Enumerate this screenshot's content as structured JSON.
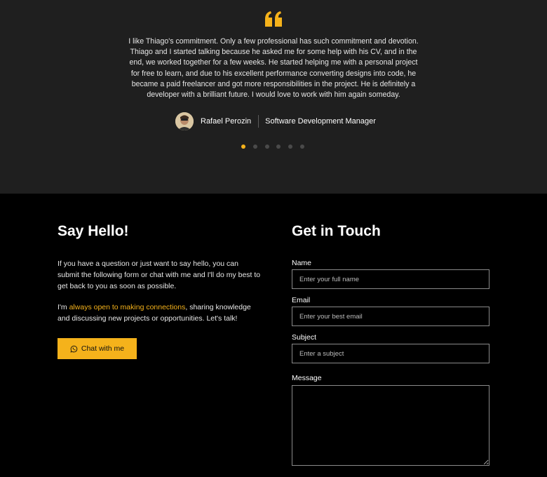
{
  "testimonial": {
    "quote_icon": "quote-icon",
    "text": "I like Thiago's commitment. Only a few professional has such commitment and devotion. Thiago and I started talking because he asked me for some help with his CV, and in the end, we worked together for a few weeks. He started helping me with a personal project for free to learn, and due to his excellent performance converting designs into code, he became a paid freelancer and got more responsibilities in the project. He is definitely a developer with a brilliant future. I would love to work with him again someday.",
    "author_name": "Rafael Perozin",
    "author_role": "Software Development Manager",
    "slide_count": 6,
    "active_slide": 1
  },
  "hello": {
    "title": "Say Hello!",
    "paragraph1": "If you have a question or just want to say hello, you can submit the following form or chat with me and I'll do my best to get back to you as soon as possible.",
    "paragraph2_prefix": "I'm ",
    "paragraph2_highlight": "always open to making connections",
    "paragraph2_suffix": ", sharing knowledge and discussing new projects or opportunities. Let's talk!",
    "chat_button_label": "Chat with me",
    "chat_button_icon": "whatsapp-icon"
  },
  "contact": {
    "title": "Get in Touch",
    "name_label": "Name",
    "name_placeholder": "Enter your full name",
    "email_label": "Email",
    "email_placeholder": "Enter your best email",
    "subject_label": "Subject",
    "subject_placeholder": "Enter a subject",
    "message_label": "Message"
  },
  "colors": {
    "accent": "#f5b21b",
    "testimonial_bg": "#1f1f1f",
    "page_bg": "#000000"
  }
}
